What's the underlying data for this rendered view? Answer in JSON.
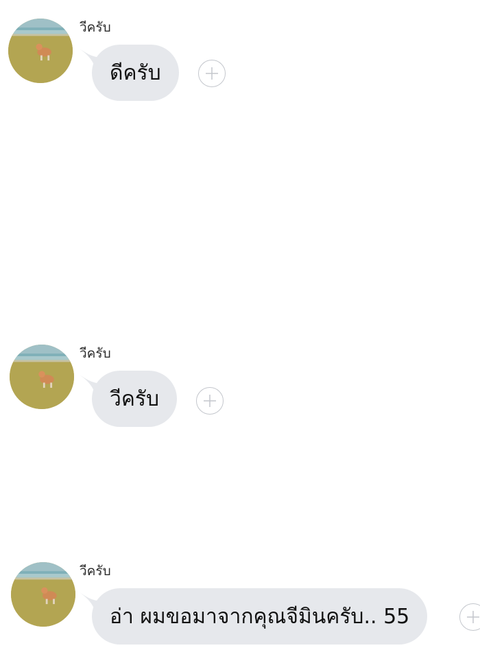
{
  "messages": [
    {
      "sender": "วีครับ",
      "text": "ดีครับ",
      "avatar_icon": "dog-on-grass-avatar",
      "action_icon": "plus-circle-icon"
    },
    {
      "sender": "วีครับ",
      "text": "วีครับ",
      "avatar_icon": "dog-on-grass-avatar",
      "action_icon": "plus-circle-icon"
    },
    {
      "sender": "วีครับ",
      "text": "อ่า ผมขอมาจากคุณจีมินครับ.. 55",
      "avatar_icon": "dog-on-grass-avatar",
      "action_icon": "plus-circle-icon"
    }
  ],
  "colors": {
    "bubble": "#e6e8ec",
    "background": "#ffffff",
    "icon_stroke": "#c3c6cc"
  }
}
